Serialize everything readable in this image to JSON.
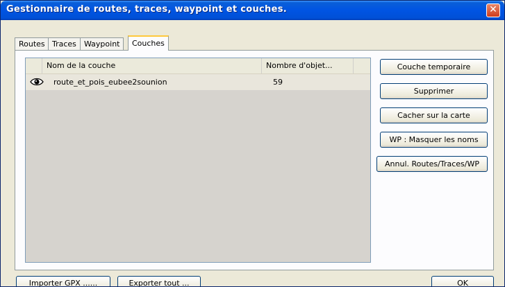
{
  "window": {
    "title": "Gestionnaire de routes, traces, waypoint et couches.",
    "close_label": "✕"
  },
  "tabs": [
    {
      "label": "Routes",
      "active": false
    },
    {
      "label": "Traces",
      "active": false
    },
    {
      "label": "Waypoint",
      "active": false
    },
    {
      "label": "Couches",
      "active": true
    }
  ],
  "layer_list": {
    "columns": [
      "Nom de la couche",
      "Nombre d'objet..."
    ],
    "rows": [
      {
        "visibility_icon": "eye-icon",
        "name": "route_et_pois_eubee2sounion",
        "count": "59"
      }
    ]
  },
  "side_buttons": [
    "Couche temporaire",
    "Supprimer",
    "Cacher sur la carte",
    "WP : Masquer les noms",
    "Annul. Routes/Traces/WP"
  ],
  "bottom_buttons": {
    "import": "Importer GPX ......",
    "export": "Exporter tout ...",
    "ok": "OK"
  }
}
